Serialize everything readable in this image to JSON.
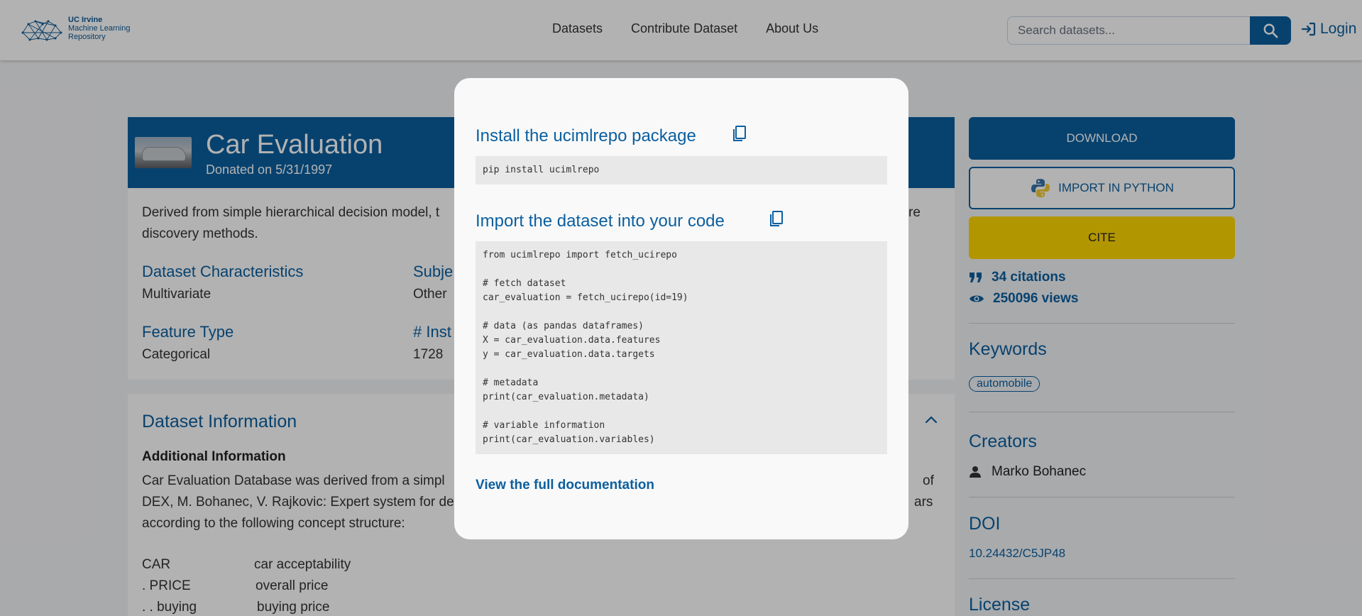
{
  "header": {
    "logo_lines": [
      "UC Irvine",
      "Machine Learning",
      "Repository"
    ],
    "nav": [
      "Datasets",
      "Contribute Dataset",
      "About Us"
    ],
    "search_placeholder": "Search datasets...",
    "login_label": "Login"
  },
  "dataset": {
    "title": "Car Evaluation",
    "donated": "Donated on 5/31/1997",
    "description_start": "Derived from simple hierarchical decision model, t",
    "description_end": "re",
    "description_line2": "discovery methods.",
    "characteristics_label": "Dataset Characteristics",
    "characteristics_value": "Multivariate",
    "subject_label": "Subje",
    "subject_value": "Other",
    "feature_type_label": "Feature Type",
    "feature_type_value": "Categorical",
    "instances_label": "# Inst",
    "instances_value": "1728"
  },
  "info": {
    "title": "Dataset Information",
    "additional_label": "Additional Information",
    "line1_start": "Car Evaluation Database was derived from a simpl",
    "line1_end": "of",
    "line2_start": "DEX, M. Bohanec, V. Rajkovic: Expert system for de",
    "line2_end": "ars",
    "line3": "according to the following concept structure:",
    "concepts": [
      {
        "name": "CAR",
        "desc": "car acceptability"
      },
      {
        "name": ". PRICE",
        "desc": "overall price"
      },
      {
        "name": ". . buying",
        "desc": "buying price"
      }
    ]
  },
  "sidebar": {
    "download_label": "DOWNLOAD",
    "python_label": "IMPORT IN PYTHON",
    "cite_label": "CITE",
    "citations": "34 citations",
    "views": "250096 views",
    "keywords_title": "Keywords",
    "keyword": "automobile",
    "creators_title": "Creators",
    "creator": "Marko Bohanec",
    "doi_title": "DOI",
    "doi": "10.24432/C5JP48",
    "license_title": "License"
  },
  "modal": {
    "install_title": "Install the ucimlrepo package",
    "install_code": "pip install ucimlrepo",
    "import_title": "Import the dataset into your code",
    "import_code": "from ucimlrepo import fetch_ucirepo\n\n# fetch dataset\ncar_evaluation = fetch_ucirepo(id=19)\n\n# data (as pandas dataframes)\nX = car_evaluation.data.features\ny = car_evaluation.data.targets\n\n# metadata\nprint(car_evaluation.metadata)\n\n# variable information\nprint(car_evaluation.variables)",
    "docs_link": "View the full documentation"
  },
  "colors": {
    "brand": "#0b5f9f",
    "cite": "#ffd700",
    "overlay": "rgba(0,0,0,0.3)"
  },
  "icons": [
    "search-icon",
    "login-icon",
    "python-icon",
    "quote-icon",
    "eye-icon",
    "person-icon",
    "chevron-up-icon",
    "copy-icon"
  ]
}
